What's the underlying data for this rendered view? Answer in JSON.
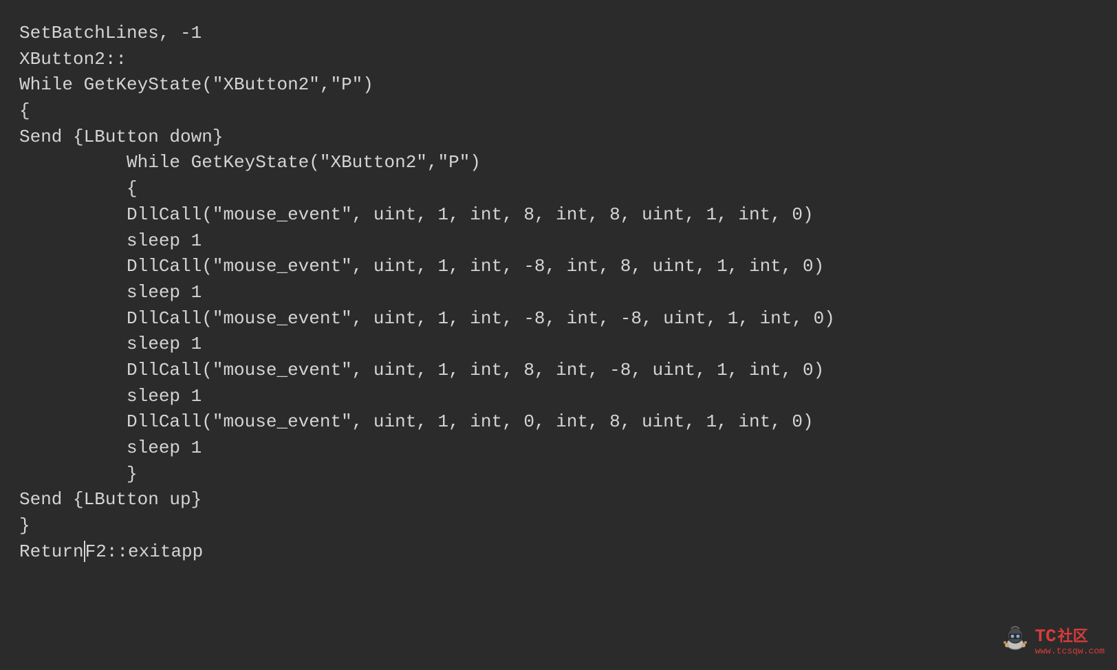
{
  "code": {
    "lines": [
      "SetBatchLines, -1",
      "XButton2::",
      "While GetKeyState(\"XButton2\",\"P\")",
      "{",
      "Send {LButton down}",
      "          While GetKeyState(\"XButton2\",\"P\")",
      "          {",
      "          DllCall(\"mouse_event\", uint, 1, int, 8, int, 8, uint, 1, int, 0)",
      "          sleep 1",
      "          DllCall(\"mouse_event\", uint, 1, int, -8, int, 8, uint, 1, int, 0)",
      "          sleep 1",
      "          DllCall(\"mouse_event\", uint, 1, int, -8, int, -8, uint, 1, int, 0)",
      "          sleep 1",
      "          DllCall(\"mouse_event\", uint, 1, int, 8, int, -8, uint, 1, int, 0)",
      "          sleep 1",
      "          DllCall(\"mouse_event\", uint, 1, int, 0, int, 8, uint, 1, int, 0)",
      "          sleep 1",
      "          }",
      "Send {LButton up}",
      "}"
    ],
    "last_line_before_cursor": "Return",
    "last_line_after_cursor": "F2::exitapp"
  },
  "watermark": {
    "brand": "TC",
    "brand_cn": "社区",
    "url": "www.tcsqw.com"
  }
}
